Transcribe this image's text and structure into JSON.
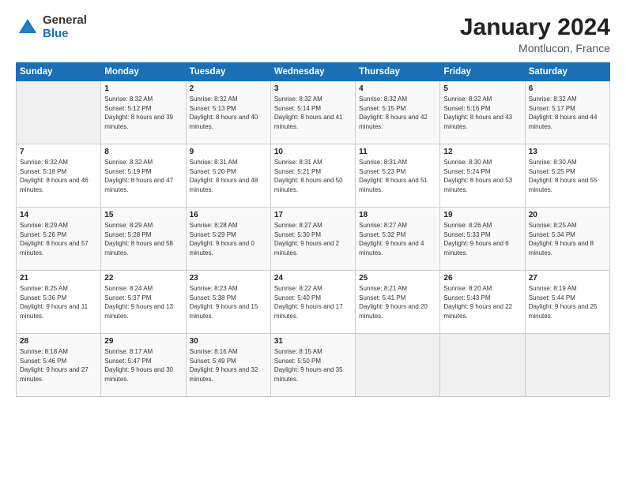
{
  "header": {
    "logo_general": "General",
    "logo_blue": "Blue",
    "title": "January 2024",
    "subtitle": "Montlucon, France"
  },
  "weekdays": [
    "Sunday",
    "Monday",
    "Tuesday",
    "Wednesday",
    "Thursday",
    "Friday",
    "Saturday"
  ],
  "weeks": [
    [
      {
        "day": "",
        "sunrise": "",
        "sunset": "",
        "daylight": ""
      },
      {
        "day": "1",
        "sunrise": "Sunrise: 8:32 AM",
        "sunset": "Sunset: 5:12 PM",
        "daylight": "Daylight: 8 hours and 39 minutes."
      },
      {
        "day": "2",
        "sunrise": "Sunrise: 8:32 AM",
        "sunset": "Sunset: 5:13 PM",
        "daylight": "Daylight: 8 hours and 40 minutes."
      },
      {
        "day": "3",
        "sunrise": "Sunrise: 8:32 AM",
        "sunset": "Sunset: 5:14 PM",
        "daylight": "Daylight: 8 hours and 41 minutes."
      },
      {
        "day": "4",
        "sunrise": "Sunrise: 8:32 AM",
        "sunset": "Sunset: 5:15 PM",
        "daylight": "Daylight: 8 hours and 42 minutes."
      },
      {
        "day": "5",
        "sunrise": "Sunrise: 8:32 AM",
        "sunset": "Sunset: 5:16 PM",
        "daylight": "Daylight: 8 hours and 43 minutes."
      },
      {
        "day": "6",
        "sunrise": "Sunrise: 8:32 AM",
        "sunset": "Sunset: 5:17 PM",
        "daylight": "Daylight: 8 hours and 44 minutes."
      }
    ],
    [
      {
        "day": "7",
        "sunrise": "Sunrise: 8:32 AM",
        "sunset": "Sunset: 5:18 PM",
        "daylight": "Daylight: 8 hours and 46 minutes."
      },
      {
        "day": "8",
        "sunrise": "Sunrise: 8:32 AM",
        "sunset": "Sunset: 5:19 PM",
        "daylight": "Daylight: 8 hours and 47 minutes."
      },
      {
        "day": "9",
        "sunrise": "Sunrise: 8:31 AM",
        "sunset": "Sunset: 5:20 PM",
        "daylight": "Daylight: 8 hours and 48 minutes."
      },
      {
        "day": "10",
        "sunrise": "Sunrise: 8:31 AM",
        "sunset": "Sunset: 5:21 PM",
        "daylight": "Daylight: 8 hours and 50 minutes."
      },
      {
        "day": "11",
        "sunrise": "Sunrise: 8:31 AM",
        "sunset": "Sunset: 5:23 PM",
        "daylight": "Daylight: 8 hours and 51 minutes."
      },
      {
        "day": "12",
        "sunrise": "Sunrise: 8:30 AM",
        "sunset": "Sunset: 5:24 PM",
        "daylight": "Daylight: 8 hours and 53 minutes."
      },
      {
        "day": "13",
        "sunrise": "Sunrise: 8:30 AM",
        "sunset": "Sunset: 5:25 PM",
        "daylight": "Daylight: 8 hours and 55 minutes."
      }
    ],
    [
      {
        "day": "14",
        "sunrise": "Sunrise: 8:29 AM",
        "sunset": "Sunset: 5:26 PM",
        "daylight": "Daylight: 8 hours and 57 minutes."
      },
      {
        "day": "15",
        "sunrise": "Sunrise: 8:29 AM",
        "sunset": "Sunset: 5:28 PM",
        "daylight": "Daylight: 8 hours and 58 minutes."
      },
      {
        "day": "16",
        "sunrise": "Sunrise: 8:28 AM",
        "sunset": "Sunset: 5:29 PM",
        "daylight": "Daylight: 9 hours and 0 minutes."
      },
      {
        "day": "17",
        "sunrise": "Sunrise: 8:27 AM",
        "sunset": "Sunset: 5:30 PM",
        "daylight": "Daylight: 9 hours and 2 minutes."
      },
      {
        "day": "18",
        "sunrise": "Sunrise: 8:27 AM",
        "sunset": "Sunset: 5:32 PM",
        "daylight": "Daylight: 9 hours and 4 minutes."
      },
      {
        "day": "19",
        "sunrise": "Sunrise: 8:26 AM",
        "sunset": "Sunset: 5:33 PM",
        "daylight": "Daylight: 9 hours and 6 minutes."
      },
      {
        "day": "20",
        "sunrise": "Sunrise: 8:25 AM",
        "sunset": "Sunset: 5:34 PM",
        "daylight": "Daylight: 9 hours and 8 minutes."
      }
    ],
    [
      {
        "day": "21",
        "sunrise": "Sunrise: 8:25 AM",
        "sunset": "Sunset: 5:36 PM",
        "daylight": "Daylight: 9 hours and 11 minutes."
      },
      {
        "day": "22",
        "sunrise": "Sunrise: 8:24 AM",
        "sunset": "Sunset: 5:37 PM",
        "daylight": "Daylight: 9 hours and 13 minutes."
      },
      {
        "day": "23",
        "sunrise": "Sunrise: 8:23 AM",
        "sunset": "Sunset: 5:38 PM",
        "daylight": "Daylight: 9 hours and 15 minutes."
      },
      {
        "day": "24",
        "sunrise": "Sunrise: 8:22 AM",
        "sunset": "Sunset: 5:40 PM",
        "daylight": "Daylight: 9 hours and 17 minutes."
      },
      {
        "day": "25",
        "sunrise": "Sunrise: 8:21 AM",
        "sunset": "Sunset: 5:41 PM",
        "daylight": "Daylight: 9 hours and 20 minutes."
      },
      {
        "day": "26",
        "sunrise": "Sunrise: 8:20 AM",
        "sunset": "Sunset: 5:43 PM",
        "daylight": "Daylight: 9 hours and 22 minutes."
      },
      {
        "day": "27",
        "sunrise": "Sunrise: 8:19 AM",
        "sunset": "Sunset: 5:44 PM",
        "daylight": "Daylight: 9 hours and 25 minutes."
      }
    ],
    [
      {
        "day": "28",
        "sunrise": "Sunrise: 8:18 AM",
        "sunset": "Sunset: 5:46 PM",
        "daylight": "Daylight: 9 hours and 27 minutes."
      },
      {
        "day": "29",
        "sunrise": "Sunrise: 8:17 AM",
        "sunset": "Sunset: 5:47 PM",
        "daylight": "Daylight: 9 hours and 30 minutes."
      },
      {
        "day": "30",
        "sunrise": "Sunrise: 8:16 AM",
        "sunset": "Sunset: 5:49 PM",
        "daylight": "Daylight: 9 hours and 32 minutes."
      },
      {
        "day": "31",
        "sunrise": "Sunrise: 8:15 AM",
        "sunset": "Sunset: 5:50 PM",
        "daylight": "Daylight: 9 hours and 35 minutes."
      },
      {
        "day": "",
        "sunrise": "",
        "sunset": "",
        "daylight": ""
      },
      {
        "day": "",
        "sunrise": "",
        "sunset": "",
        "daylight": ""
      },
      {
        "day": "",
        "sunrise": "",
        "sunset": "",
        "daylight": ""
      }
    ]
  ]
}
